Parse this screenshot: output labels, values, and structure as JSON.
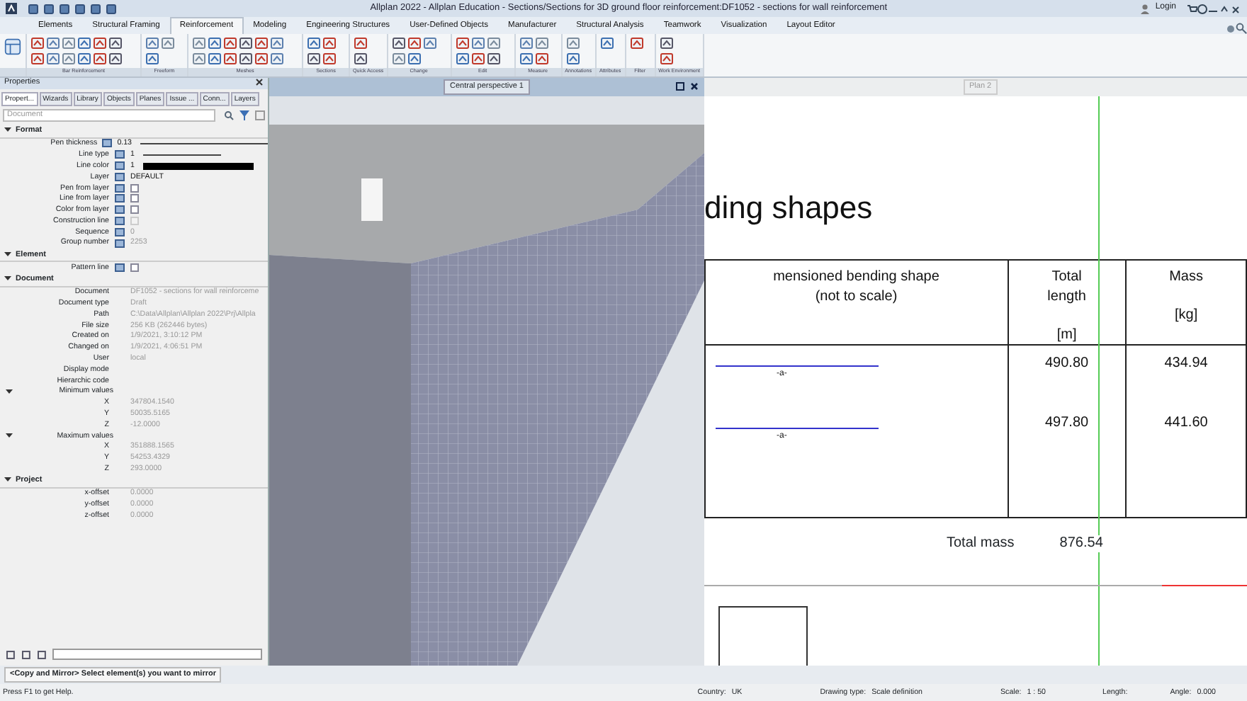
{
  "window": {
    "title": "Allplan 2022 - Allplan Education - Sections/Sections for 3D ground floor reinforcement:DF1052 - sections for wall reinforcement",
    "login": "Login"
  },
  "ribbon_tabs": [
    {
      "label": "Elements",
      "selected": false
    },
    {
      "label": "Structural Framing",
      "selected": false
    },
    {
      "label": "Reinforcement",
      "selected": true
    },
    {
      "label": "Modeling",
      "selected": false
    },
    {
      "label": "Engineering Structures",
      "selected": false
    },
    {
      "label": "User-Defined Objects",
      "selected": false
    },
    {
      "label": "Manufacturer",
      "selected": false
    },
    {
      "label": "Structural Analysis",
      "selected": false
    },
    {
      "label": "Teamwork",
      "selected": false
    },
    {
      "label": "Visualization",
      "selected": false
    },
    {
      "label": "Layout Editor",
      "selected": false
    }
  ],
  "ribbon_groups": [
    "Bar Reinforcement",
    "Freeform",
    "Meshes",
    "Sections",
    "Quick Access",
    "Change",
    "Edit",
    "Measure",
    "Annotations",
    "Attributes",
    "Filter",
    "Work Environment"
  ],
  "properties": {
    "title": "Properties",
    "tabs": [
      {
        "label": "Propert...",
        "selected": true
      },
      {
        "label": "Wizards",
        "selected": false
      },
      {
        "label": "Library",
        "selected": false
      },
      {
        "label": "Objects",
        "selected": false
      },
      {
        "label": "Planes",
        "selected": false
      },
      {
        "label": "Issue ...",
        "selected": false
      },
      {
        "label": "Conn...",
        "selected": false
      },
      {
        "label": "Layers",
        "selected": false
      }
    ],
    "filter_placeholder": "Document",
    "sections": [
      {
        "title": "Format",
        "icons": true,
        "rows": [
          {
            "label": "Pen thickness",
            "kind": "line",
            "value": "0.13",
            "disabled": false
          },
          {
            "label": "Line type",
            "kind": "line",
            "value": "1",
            "disabled": false
          },
          {
            "label": "Line color",
            "kind": "color",
            "value": "1",
            "disabled": false
          },
          {
            "label": "Layer",
            "kind": "text",
            "value": "DEFAULT",
            "disabled": false
          },
          {
            "label": "Pen from layer",
            "kind": "checkbox",
            "checked": false,
            "disabled": false
          },
          {
            "label": "Line from layer",
            "kind": "checkbox",
            "checked": false,
            "disabled": false
          },
          {
            "label": "Color from layer",
            "kind": "checkbox",
            "checked": false,
            "disabled": false
          },
          {
            "label": "Construction line",
            "kind": "checkbox",
            "checked": false,
            "disabled": true
          },
          {
            "label": "Sequence",
            "kind": "text",
            "value": "0",
            "disabled": true
          },
          {
            "label": "Group number",
            "kind": "text",
            "value": "2253",
            "disabled": true
          }
        ]
      },
      {
        "title": "Element",
        "icons": true,
        "rows": [
          {
            "label": "Pattern line",
            "kind": "checkbox",
            "checked": false,
            "disabled": false
          }
        ]
      },
      {
        "title": "Document",
        "icons": false,
        "rows": [
          {
            "label": "Document",
            "kind": "text",
            "value": "DF1052 - sections for wall reinforceme",
            "disabled": true
          },
          {
            "label": "Document type",
            "kind": "text",
            "value": "Draft",
            "disabled": true
          },
          {
            "label": "Path",
            "kind": "text",
            "value": "C:\\Data\\Allplan\\Allplan 2022\\Prj\\Allpla",
            "disabled": true
          },
          {
            "label": "File size",
            "kind": "text",
            "value": "256 KB (262446 bytes)",
            "disabled": true
          },
          {
            "label": "Created on",
            "kind": "text",
            "value": "1/9/2021, 3:10:12 PM",
            "disabled": true
          },
          {
            "label": "Changed on",
            "kind": "text",
            "value": "1/9/2021, 4:06:51 PM",
            "disabled": true
          },
          {
            "label": "User",
            "kind": "text",
            "value": "local",
            "disabled": true
          },
          {
            "label": "Display mode",
            "kind": "empty"
          },
          {
            "label": "Hierarchic code",
            "kind": "empty"
          },
          {
            "label": "Minimum values",
            "kind": "group",
            "expanded": true,
            "children": [
              {
                "label": "X",
                "kind": "text",
                "value": "347804.1540",
                "disabled": true
              },
              {
                "label": "Y",
                "kind": "text",
                "value": "50035.5165",
                "disabled": true
              },
              {
                "label": "Z",
                "kind": "text",
                "value": "-12.0000",
                "disabled": true
              }
            ]
          },
          {
            "label": "Maximum values",
            "kind": "group",
            "expanded": true,
            "children": [
              {
                "label": "X",
                "kind": "text",
                "value": "351888.1565",
                "disabled": true
              },
              {
                "label": "Y",
                "kind": "text",
                "value": "54253.4329",
                "disabled": true
              },
              {
                "label": "Z",
                "kind": "text",
                "value": "293.0000",
                "disabled": true
              }
            ]
          }
        ]
      },
      {
        "title": "Project",
        "icons": false,
        "rows": [
          {
            "label": "x-offset",
            "kind": "text",
            "value": "0.0000",
            "disabled": true
          },
          {
            "label": "y-offset",
            "kind": "text",
            "value": "0.0000",
            "disabled": true
          },
          {
            "label": "z-offset",
            "kind": "text",
            "value": "0.0000",
            "disabled": true
          }
        ]
      }
    ]
  },
  "viewport": {
    "tab": "Central perspective 1"
  },
  "sheet": {
    "tab": "Plan 2",
    "title": "ding shapes",
    "columns": [
      "mensioned bending shape\n(not to scale)",
      "Total\nlength\n\n[m]",
      "Mass\n\n[kg]"
    ],
    "rows": [
      {
        "shape_label": "-a-",
        "length": "490.80",
        "mass": "434.94"
      },
      {
        "shape_label": "-a-",
        "length": "497.80",
        "mass": "441.60"
      }
    ],
    "total_label": "Total mass",
    "total_value": "876.54"
  },
  "prompt": "<Copy and Mirror> Select element(s) you want to mirror",
  "status_bar": {
    "help": "Press F1 to get Help.",
    "items": [
      {
        "label": "Country:",
        "value": "UK"
      },
      {
        "label": "Drawing type:",
        "value": "Scale definition"
      },
      {
        "label": "Scale:",
        "value": "1 : 50"
      },
      {
        "label": "Length:"
      },
      {
        "label": "Angle:",
        "value": "0.000"
      }
    ]
  }
}
